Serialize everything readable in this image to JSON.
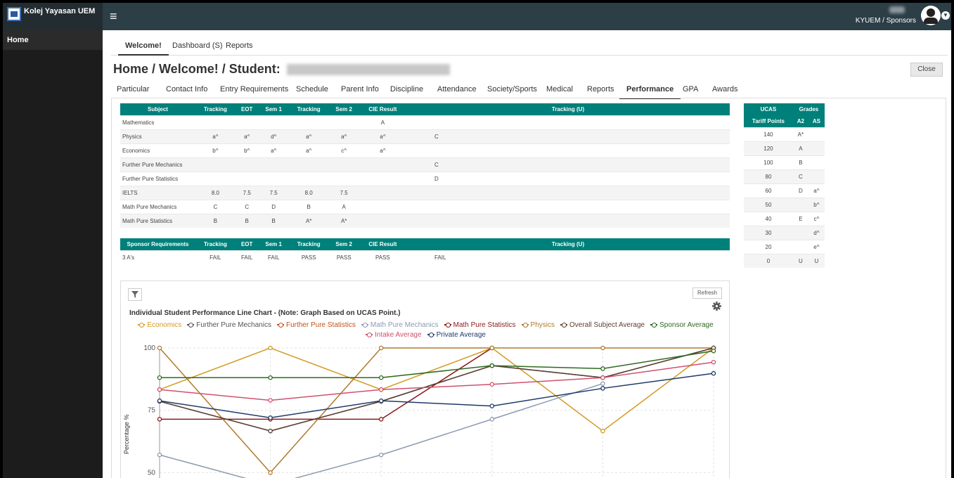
{
  "header": {
    "app_name": "Kolej Yayasan UEM",
    "user_role": "KYUEM / Sponsors"
  },
  "sidebar": {
    "items": [
      {
        "label": "Home"
      }
    ]
  },
  "tabs": [
    "Welcome!",
    "Dashboard (S)",
    "Reports"
  ],
  "page_title_prefix": "Home / Welcome! / Student:",
  "close_label": "Close",
  "subtabs": [
    "Particular",
    "Contact Info",
    "Entry Requirements",
    "Schedule",
    "Parent Info",
    "Discipline",
    "Attendance",
    "Society/Sports",
    "Medical",
    "Reports",
    "Performance",
    "GPA",
    "Awards"
  ],
  "active_subtab": "Performance",
  "subjects_table": {
    "headers": [
      "Subject",
      "Tracking",
      "EOT",
      "Sem 1",
      "Tracking",
      "Sem 2",
      "CIE Result",
      "Tracking (U)"
    ],
    "rows": [
      [
        "Mathematics",
        "",
        "",
        "",
        "",
        "",
        "A",
        ""
      ],
      [
        "Physics",
        "a^",
        "a^",
        "d^",
        "a^",
        "a^",
        "a^",
        "C"
      ],
      [
        "Economics",
        "b^",
        "b^",
        "a^",
        "a^",
        "c^",
        "a^",
        ""
      ],
      [
        "Further Pure Mechanics",
        "",
        "",
        "",
        "",
        "",
        "",
        "C"
      ],
      [
        "Further Pure Statistics",
        "",
        "",
        "",
        "",
        "",
        "",
        "D"
      ],
      [
        "IELTS",
        "8.0",
        "7.5",
        "7.5",
        "8.0",
        "7.5",
        "",
        ""
      ],
      [
        "Math Pure Mechanics",
        "C",
        "C",
        "D",
        "B",
        "A",
        "",
        ""
      ],
      [
        "Math Pure Statistics",
        "B",
        "B",
        "B",
        "A*",
        "A*",
        "",
        ""
      ]
    ]
  },
  "sponsor_table": {
    "headers": [
      "Sponsor Requirements",
      "Tracking",
      "EOT",
      "Sem 1",
      "Tracking",
      "Sem 2",
      "CIE Result",
      "Tracking (U)"
    ],
    "rows": [
      [
        "3 A's",
        "FAIL",
        "FAIL",
        "FAIL",
        "PASS",
        "PASS",
        "PASS",
        "FAIL"
      ]
    ]
  },
  "ucas_table": {
    "header_top": [
      "UCAS",
      "Grades"
    ],
    "header_sub": [
      "Tariff Points",
      "A2",
      "AS"
    ],
    "rows": [
      [
        "140",
        "A*",
        ""
      ],
      [
        "120",
        "A",
        ""
      ],
      [
        "100",
        "B",
        ""
      ],
      [
        "80",
        "C",
        ""
      ],
      [
        "60",
        "D",
        "a^"
      ],
      [
        "50",
        "",
        "b^"
      ],
      [
        "40",
        "E",
        "c^"
      ],
      [
        "30",
        "",
        "d^"
      ],
      [
        "20",
        "",
        "e^"
      ],
      [
        "0",
        "U",
        "U"
      ]
    ]
  },
  "chart": {
    "refresh_label": "Refresh",
    "title": "Individual Student Performance Line Chart - (Note: Graph Based on UCAS Point.)"
  },
  "chart_data": {
    "type": "line",
    "title": "Individual Student Performance Line Chart - (Note: Graph Based on UCAS Point.)",
    "ylabel": "Percentage %",
    "xlabel": "",
    "ylim": [
      45,
      100
    ],
    "yticks": [
      50,
      75,
      100
    ],
    "x": [
      1,
      2,
      3,
      4,
      5,
      6
    ],
    "series": [
      {
        "name": "Economics",
        "color": "#d39a22",
        "values": [
          83.3,
          100,
          83.3,
          100,
          66.7,
          100
        ]
      },
      {
        "name": "Further Pure Mechanics",
        "color": "#555555",
        "values": [
          78.6,
          66.7,
          78.6,
          92.9,
          88.1,
          100
        ]
      },
      {
        "name": "Further Pure Statistics",
        "color": "#c4531c",
        "values": [
          null,
          null,
          null,
          null,
          null,
          null
        ]
      },
      {
        "name": "Math Pure Mechanics",
        "color": "#8a9bb0",
        "values": [
          57.1,
          45,
          57.1,
          71.4,
          85.7,
          null
        ]
      },
      {
        "name": "Math Pure Statistics",
        "color": "#8b1a1a",
        "values": [
          71.4,
          71.4,
          71.4,
          100,
          null,
          null
        ]
      },
      {
        "name": "Physics",
        "color": "#b07a2a",
        "values": [
          100,
          50,
          100,
          100,
          100,
          100
        ]
      },
      {
        "name": "Overall Subject Average",
        "color": "#5c4033",
        "values": [
          78.6,
          66.7,
          78.6,
          92.9,
          88.1,
          100
        ]
      },
      {
        "name": "Sponsor Average",
        "color": "#2d6a1f",
        "values": [
          88.1,
          88.1,
          88.1,
          92.9,
          91.7,
          98.8
        ]
      },
      {
        "name": "Intake Average",
        "color": "#d0506e",
        "values": [
          83.3,
          79,
          83.3,
          85.4,
          88.1,
          94.3
        ]
      },
      {
        "name": "Private Average",
        "color": "#1f3a6b",
        "values": [
          78.8,
          72,
          78.8,
          76.7,
          83.8,
          89.8
        ]
      }
    ]
  }
}
